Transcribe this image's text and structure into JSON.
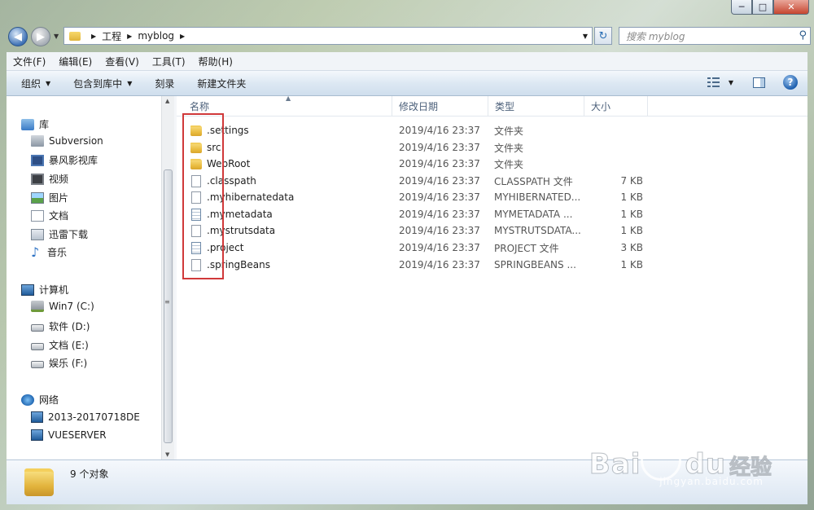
{
  "window_controls": {
    "minimize": "─",
    "maximize": "□",
    "close": "✕"
  },
  "address": {
    "crumbs": [
      "工程",
      "myblog"
    ]
  },
  "search": {
    "placeholder": "搜索 myblog"
  },
  "menu": [
    "文件(F)",
    "编辑(E)",
    "查看(V)",
    "工具(T)",
    "帮助(H)"
  ],
  "command_bar": {
    "organize": "组织",
    "include_library": "包含到库中",
    "burn": "刻录",
    "new_folder": "新建文件夹"
  },
  "nav": {
    "libraries": {
      "label": "库",
      "items": [
        "Subversion",
        "暴风影视库",
        "视频",
        "图片",
        "文档",
        "迅雷下载",
        "音乐"
      ]
    },
    "computer": {
      "label": "计算机",
      "items": [
        "Win7 (C:)",
        "软件 (D:)",
        "文档 (E:)",
        "娱乐 (F:)"
      ]
    },
    "network": {
      "label": "网络",
      "items": [
        "2013-20170718DE",
        "VUESERVER"
      ]
    }
  },
  "columns": {
    "name": "名称",
    "date": "修改日期",
    "type": "类型",
    "size": "大小"
  },
  "files": [
    {
      "name": ".settings",
      "date": "2019/4/16 23:37",
      "type": "文件夹",
      "size": "",
      "icon": "folder"
    },
    {
      "name": "src",
      "date": "2019/4/16 23:37",
      "type": "文件夹",
      "size": "",
      "icon": "folder"
    },
    {
      "name": "WebRoot",
      "date": "2019/4/16 23:37",
      "type": "文件夹",
      "size": "",
      "icon": "folder"
    },
    {
      "name": ".classpath",
      "date": "2019/4/16 23:37",
      "type": "CLASSPATH 文件",
      "size": "7 KB",
      "icon": "file"
    },
    {
      "name": ".myhibernatedata",
      "date": "2019/4/16 23:37",
      "type": "MYHIBERNATED...",
      "size": "1 KB",
      "icon": "file"
    },
    {
      "name": ".mymetadata",
      "date": "2019/4/16 23:37",
      "type": "MYMETADATA ...",
      "size": "1 KB",
      "icon": "text-file"
    },
    {
      "name": ".mystrutsdata",
      "date": "2019/4/16 23:37",
      "type": "MYSTRUTSDATA...",
      "size": "1 KB",
      "icon": "file"
    },
    {
      "name": ".project",
      "date": "2019/4/16 23:37",
      "type": "PROJECT 文件",
      "size": "3 KB",
      "icon": "text-file"
    },
    {
      "name": ".springBeans",
      "date": "2019/4/16 23:37",
      "type": "SPRINGBEANS ...",
      "size": "1 KB",
      "icon": "file"
    }
  ],
  "status": {
    "count": "9 个对象"
  },
  "watermark": {
    "brand": "Bai",
    "brand_end": "du",
    "brand_cn": "经验",
    "url": "jingyan.baidu.com"
  },
  "colors": {
    "highlight_box": "#d0393a",
    "folder": "#e9bc3f",
    "accent": "#3f72b5"
  }
}
